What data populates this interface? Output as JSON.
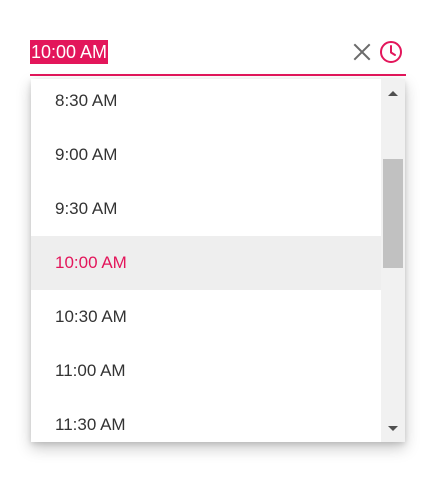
{
  "input": {
    "value": "10:00 AM",
    "clear_icon": "close-icon",
    "popup_icon": "clock-icon",
    "accent_color": "#e3165b"
  },
  "list": {
    "items": [
      {
        "label": "8:30 AM",
        "selected": false
      },
      {
        "label": "9:00 AM",
        "selected": false
      },
      {
        "label": "9:30 AM",
        "selected": false
      },
      {
        "label": "10:00 AM",
        "selected": true
      },
      {
        "label": "10:30 AM",
        "selected": false
      },
      {
        "label": "11:00 AM",
        "selected": false
      },
      {
        "label": "11:30 AM",
        "selected": false
      }
    ]
  },
  "scrollbar": {
    "up_icon": "triangle-up-icon",
    "down_icon": "triangle-down-icon"
  }
}
